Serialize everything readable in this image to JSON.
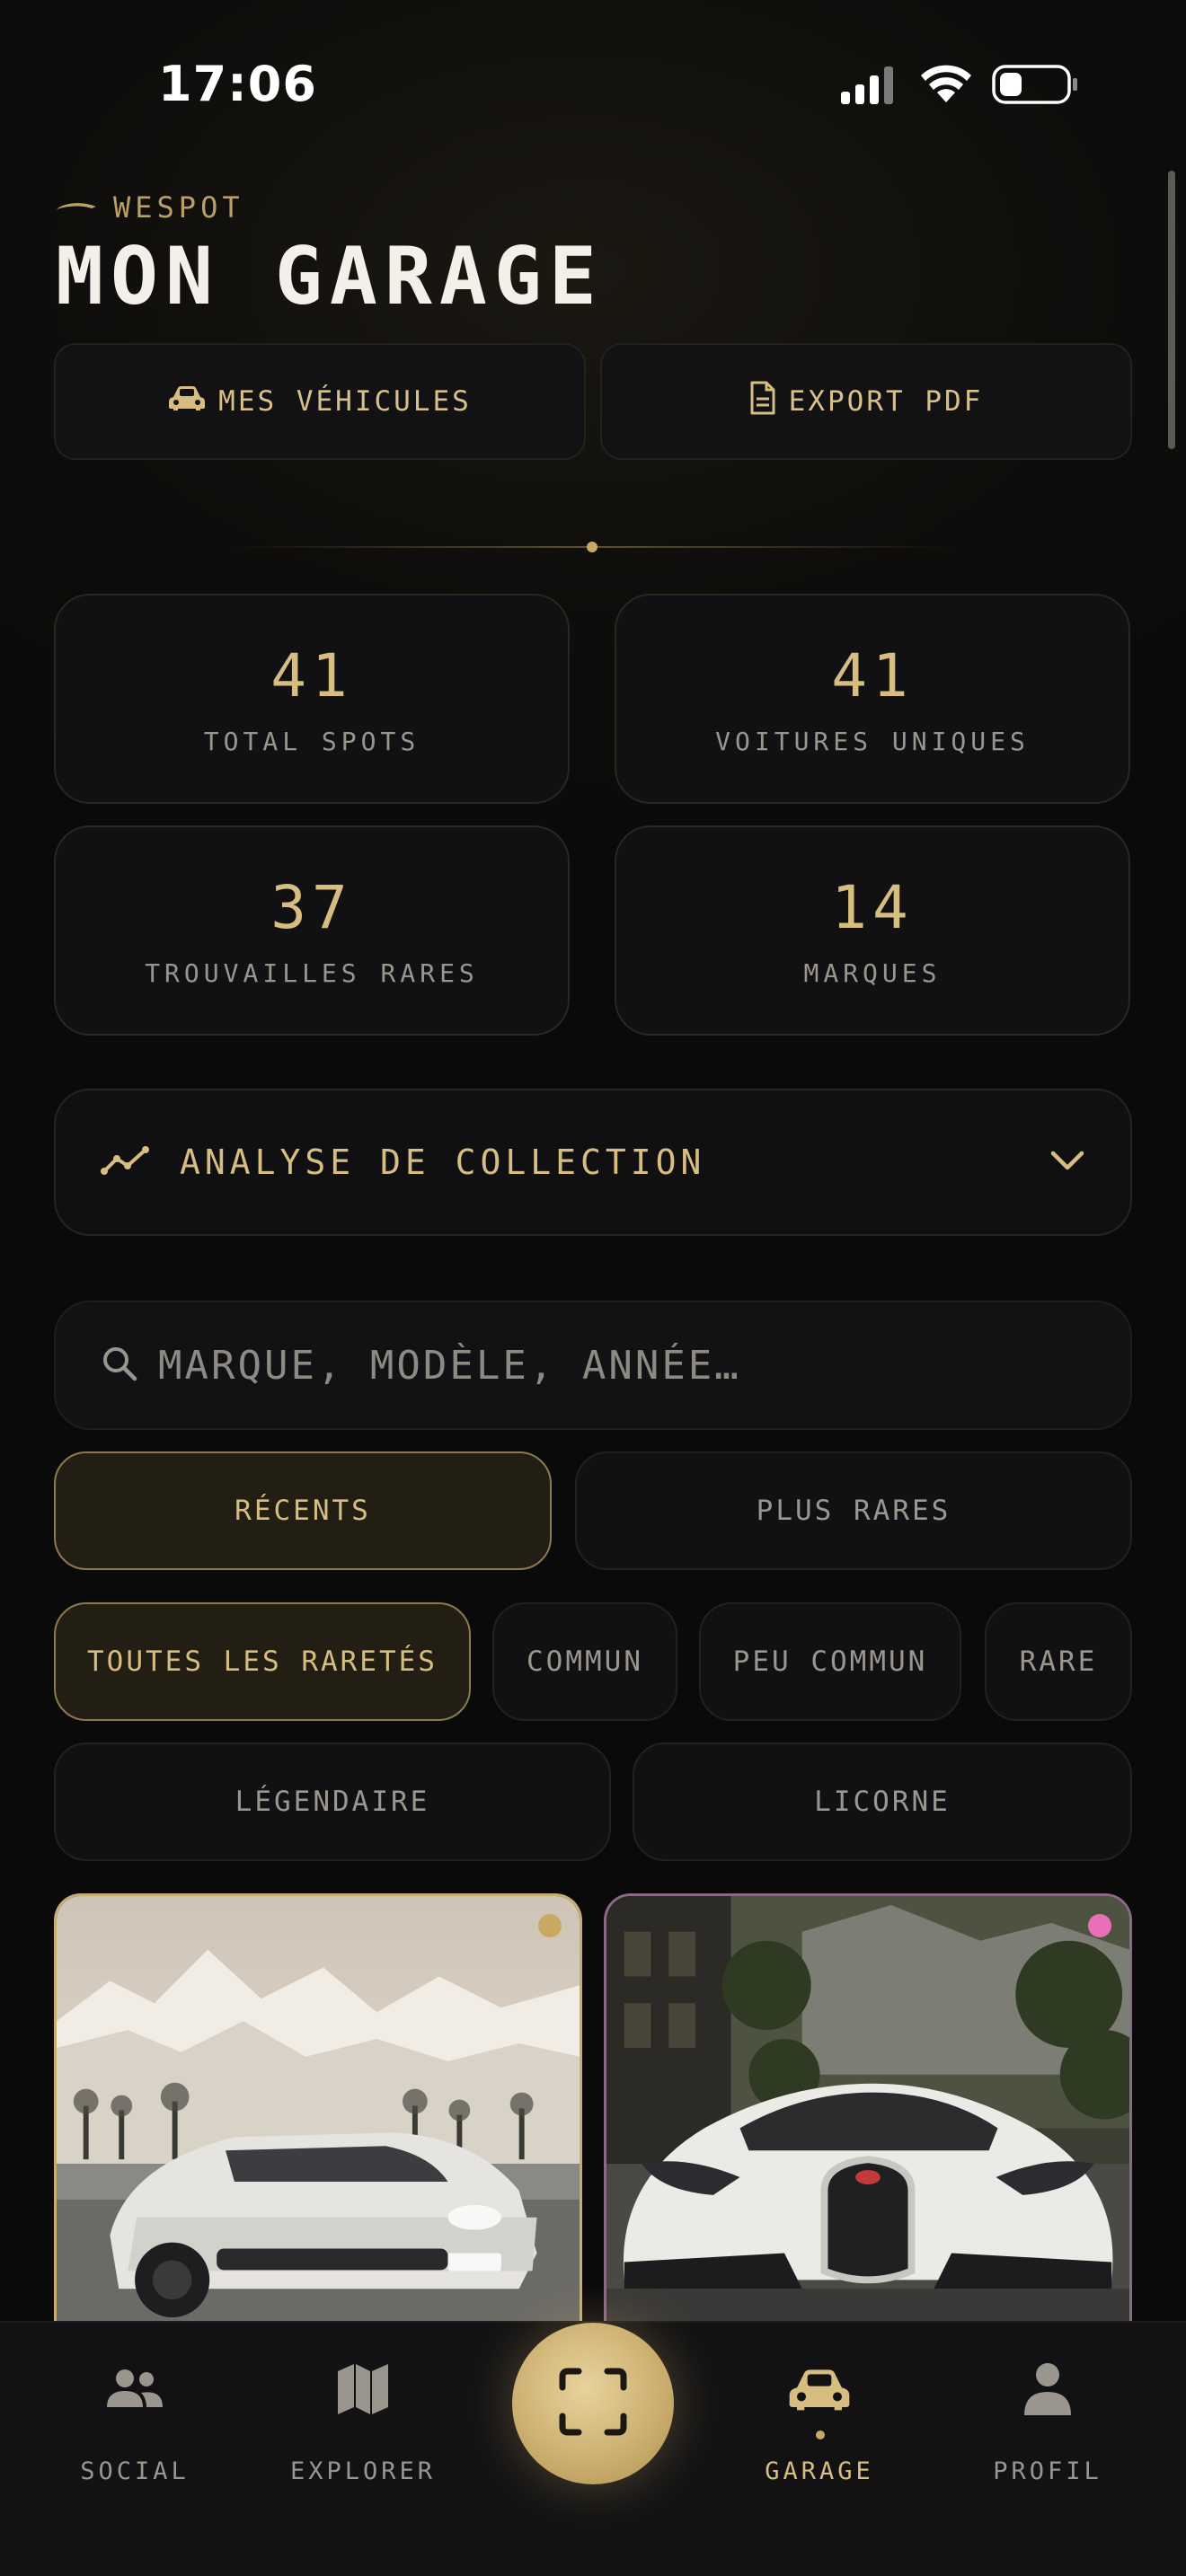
{
  "status_bar": {
    "time": "17:06"
  },
  "header": {
    "brand": "WESPOT",
    "title": "MON GARAGE"
  },
  "actions": {
    "vehicles_label": "MES VÉHICULES",
    "export_label": "EXPORT PDF"
  },
  "stats": [
    {
      "value": "41",
      "label": "TOTAL SPOTS"
    },
    {
      "value": "41",
      "label": "VOITURES UNIQUES"
    },
    {
      "value": "37",
      "label": "TROUVAILLES RARES"
    },
    {
      "value": "14",
      "label": "MARQUES"
    }
  ],
  "analysis": {
    "label": "ANALYSE DE COLLECTION",
    "expanded": false
  },
  "search": {
    "placeholder": "MARQUE, MODÈLE, ANNÉE…",
    "value": ""
  },
  "sort_options": [
    {
      "label": "RÉCENTS",
      "selected": true
    },
    {
      "label": "PLUS RARES",
      "selected": false
    }
  ],
  "rarity_filters": [
    {
      "label": "TOUTES LES RARETÉS",
      "selected": true
    },
    {
      "label": "COMMUN",
      "selected": false
    },
    {
      "label": "PEU COMMUN",
      "selected": false
    },
    {
      "label": "RARE",
      "selected": false
    },
    {
      "label": "LÉGENDAIRE",
      "selected": false
    },
    {
      "label": "LICORNE",
      "selected": false
    }
  ],
  "cards": [
    {
      "subject": "white Porsche 911 GT3 on snowy mountain road",
      "rarity_color": "#c9a962"
    },
    {
      "subject": "white Bugatti Chiron on forest road",
      "rarity_color": "#e86fb8"
    }
  ],
  "nav": {
    "items": [
      {
        "label": "SOCIAL",
        "icon": "users-icon",
        "active": false
      },
      {
        "label": "EXPLORER",
        "icon": "map-icon",
        "active": false
      },
      {
        "label": "GARAGE",
        "icon": "car-icon",
        "active": true
      },
      {
        "label": "PROFIL",
        "icon": "user-icon",
        "active": false
      }
    ],
    "scan_icon": "scan-icon"
  },
  "colors": {
    "accent": "#d7bd80",
    "background": "#0a0a0b",
    "card": "#111114",
    "unicorn": "#e86fb8"
  }
}
